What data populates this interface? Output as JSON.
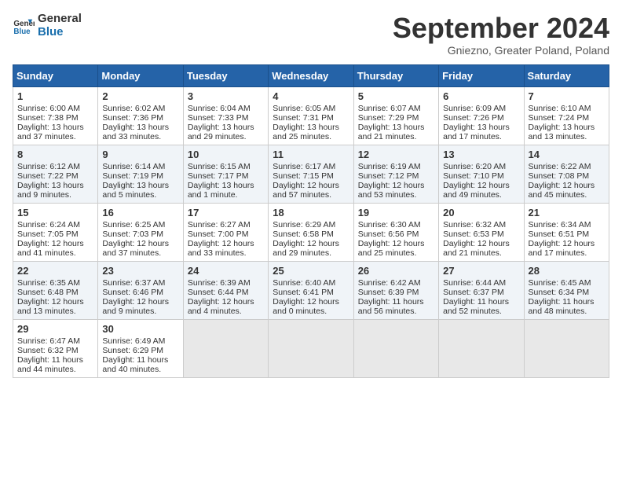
{
  "header": {
    "logo_line1": "General",
    "logo_line2": "Blue",
    "month_title": "September 2024",
    "subtitle": "Gniezno, Greater Poland, Poland"
  },
  "calendar": {
    "days_of_week": [
      "Sunday",
      "Monday",
      "Tuesday",
      "Wednesday",
      "Thursday",
      "Friday",
      "Saturday"
    ],
    "weeks": [
      [
        null,
        {
          "day": "2",
          "sunrise": "Sunrise: 6:02 AM",
          "sunset": "Sunset: 7:36 PM",
          "daylight": "Daylight: 13 hours and 33 minutes."
        },
        {
          "day": "3",
          "sunrise": "Sunrise: 6:04 AM",
          "sunset": "Sunset: 7:33 PM",
          "daylight": "Daylight: 13 hours and 29 minutes."
        },
        {
          "day": "4",
          "sunrise": "Sunrise: 6:05 AM",
          "sunset": "Sunset: 7:31 PM",
          "daylight": "Daylight: 13 hours and 25 minutes."
        },
        {
          "day": "5",
          "sunrise": "Sunrise: 6:07 AM",
          "sunset": "Sunset: 7:29 PM",
          "daylight": "Daylight: 13 hours and 21 minutes."
        },
        {
          "day": "6",
          "sunrise": "Sunrise: 6:09 AM",
          "sunset": "Sunset: 7:26 PM",
          "daylight": "Daylight: 13 hours and 17 minutes."
        },
        {
          "day": "7",
          "sunrise": "Sunrise: 6:10 AM",
          "sunset": "Sunset: 7:24 PM",
          "daylight": "Daylight: 13 hours and 13 minutes."
        }
      ],
      [
        {
          "day": "1",
          "sunrise": "Sunrise: 6:00 AM",
          "sunset": "Sunset: 7:38 PM",
          "daylight": "Daylight: 13 hours and 37 minutes."
        },
        {
          "day": "9",
          "sunrise": "Sunrise: 6:14 AM",
          "sunset": "Sunset: 7:19 PM",
          "daylight": "Daylight: 13 hours and 5 minutes."
        },
        {
          "day": "10",
          "sunrise": "Sunrise: 6:15 AM",
          "sunset": "Sunset: 7:17 PM",
          "daylight": "Daylight: 13 hours and 1 minute."
        },
        {
          "day": "11",
          "sunrise": "Sunrise: 6:17 AM",
          "sunset": "Sunset: 7:15 PM",
          "daylight": "Daylight: 12 hours and 57 minutes."
        },
        {
          "day": "12",
          "sunrise": "Sunrise: 6:19 AM",
          "sunset": "Sunset: 7:12 PM",
          "daylight": "Daylight: 12 hours and 53 minutes."
        },
        {
          "day": "13",
          "sunrise": "Sunrise: 6:20 AM",
          "sunset": "Sunset: 7:10 PM",
          "daylight": "Daylight: 12 hours and 49 minutes."
        },
        {
          "day": "14",
          "sunrise": "Sunrise: 6:22 AM",
          "sunset": "Sunset: 7:08 PM",
          "daylight": "Daylight: 12 hours and 45 minutes."
        }
      ],
      [
        {
          "day": "8",
          "sunrise": "Sunrise: 6:12 AM",
          "sunset": "Sunset: 7:22 PM",
          "daylight": "Daylight: 13 hours and 9 minutes."
        },
        {
          "day": "16",
          "sunrise": "Sunrise: 6:25 AM",
          "sunset": "Sunset: 7:03 PM",
          "daylight": "Daylight: 12 hours and 37 minutes."
        },
        {
          "day": "17",
          "sunrise": "Sunrise: 6:27 AM",
          "sunset": "Sunset: 7:00 PM",
          "daylight": "Daylight: 12 hours and 33 minutes."
        },
        {
          "day": "18",
          "sunrise": "Sunrise: 6:29 AM",
          "sunset": "Sunset: 6:58 PM",
          "daylight": "Daylight: 12 hours and 29 minutes."
        },
        {
          "day": "19",
          "sunrise": "Sunrise: 6:30 AM",
          "sunset": "Sunset: 6:56 PM",
          "daylight": "Daylight: 12 hours and 25 minutes."
        },
        {
          "day": "20",
          "sunrise": "Sunrise: 6:32 AM",
          "sunset": "Sunset: 6:53 PM",
          "daylight": "Daylight: 12 hours and 21 minutes."
        },
        {
          "day": "21",
          "sunrise": "Sunrise: 6:34 AM",
          "sunset": "Sunset: 6:51 PM",
          "daylight": "Daylight: 12 hours and 17 minutes."
        }
      ],
      [
        {
          "day": "15",
          "sunrise": "Sunrise: 6:24 AM",
          "sunset": "Sunset: 7:05 PM",
          "daylight": "Daylight: 12 hours and 41 minutes."
        },
        {
          "day": "23",
          "sunrise": "Sunrise: 6:37 AM",
          "sunset": "Sunset: 6:46 PM",
          "daylight": "Daylight: 12 hours and 9 minutes."
        },
        {
          "day": "24",
          "sunrise": "Sunrise: 6:39 AM",
          "sunset": "Sunset: 6:44 PM",
          "daylight": "Daylight: 12 hours and 4 minutes."
        },
        {
          "day": "25",
          "sunrise": "Sunrise: 6:40 AM",
          "sunset": "Sunset: 6:41 PM",
          "daylight": "Daylight: 12 hours and 0 minutes."
        },
        {
          "day": "26",
          "sunrise": "Sunrise: 6:42 AM",
          "sunset": "Sunset: 6:39 PM",
          "daylight": "Daylight: 11 hours and 56 minutes."
        },
        {
          "day": "27",
          "sunrise": "Sunrise: 6:44 AM",
          "sunset": "Sunset: 6:37 PM",
          "daylight": "Daylight: 11 hours and 52 minutes."
        },
        {
          "day": "28",
          "sunrise": "Sunrise: 6:45 AM",
          "sunset": "Sunset: 6:34 PM",
          "daylight": "Daylight: 11 hours and 48 minutes."
        }
      ],
      [
        {
          "day": "22",
          "sunrise": "Sunrise: 6:35 AM",
          "sunset": "Sunset: 6:48 PM",
          "daylight": "Daylight: 12 hours and 13 minutes."
        },
        {
          "day": "30",
          "sunrise": "Sunrise: 6:49 AM",
          "sunset": "Sunset: 6:29 PM",
          "daylight": "Daylight: 11 hours and 40 minutes."
        },
        null,
        null,
        null,
        null,
        null
      ],
      [
        {
          "day": "29",
          "sunrise": "Sunrise: 6:47 AM",
          "sunset": "Sunset: 6:32 PM",
          "daylight": "Daylight: 11 hours and 44 minutes."
        },
        null,
        null,
        null,
        null,
        null,
        null
      ]
    ]
  }
}
